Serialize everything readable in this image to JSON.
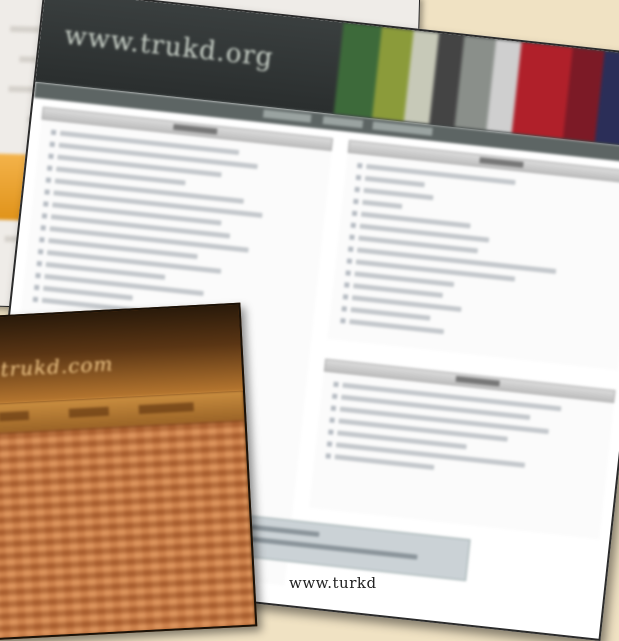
{
  "main_card": {
    "site_logo": "www.trukd.org"
  },
  "orange_card": {
    "site_title": "trukd.com"
  },
  "caption": "www.turkd",
  "colors": {
    "background": "#f0e2c3",
    "header_dark": "#2e3333",
    "orange_accent": "#b6762f"
  }
}
